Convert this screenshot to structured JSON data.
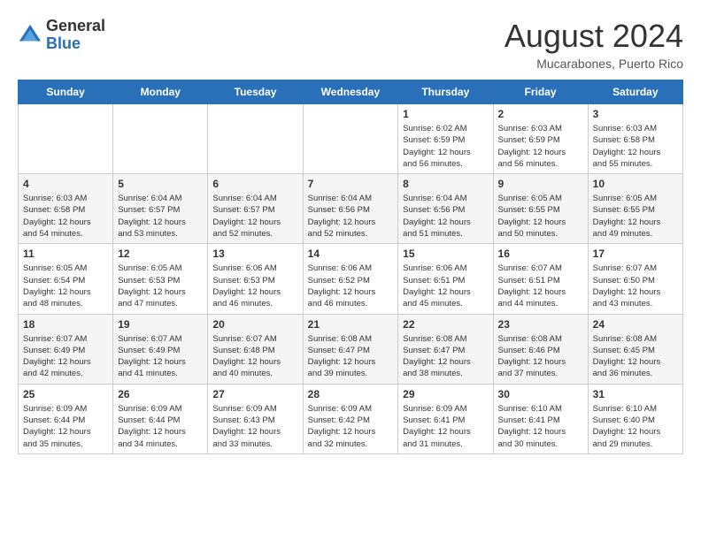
{
  "header": {
    "logo_general": "General",
    "logo_blue": "Blue",
    "month_year": "August 2024",
    "location": "Mucarabones, Puerto Rico"
  },
  "weekdays": [
    "Sunday",
    "Monday",
    "Tuesday",
    "Wednesday",
    "Thursday",
    "Friday",
    "Saturday"
  ],
  "weeks": [
    [
      {
        "day": "",
        "info": ""
      },
      {
        "day": "",
        "info": ""
      },
      {
        "day": "",
        "info": ""
      },
      {
        "day": "",
        "info": ""
      },
      {
        "day": "1",
        "info": "Sunrise: 6:02 AM\nSunset: 6:59 PM\nDaylight: 12 hours\nand 56 minutes."
      },
      {
        "day": "2",
        "info": "Sunrise: 6:03 AM\nSunset: 6:59 PM\nDaylight: 12 hours\nand 56 minutes."
      },
      {
        "day": "3",
        "info": "Sunrise: 6:03 AM\nSunset: 6:58 PM\nDaylight: 12 hours\nand 55 minutes."
      }
    ],
    [
      {
        "day": "4",
        "info": "Sunrise: 6:03 AM\nSunset: 6:58 PM\nDaylight: 12 hours\nand 54 minutes."
      },
      {
        "day": "5",
        "info": "Sunrise: 6:04 AM\nSunset: 6:57 PM\nDaylight: 12 hours\nand 53 minutes."
      },
      {
        "day": "6",
        "info": "Sunrise: 6:04 AM\nSunset: 6:57 PM\nDaylight: 12 hours\nand 52 minutes."
      },
      {
        "day": "7",
        "info": "Sunrise: 6:04 AM\nSunset: 6:56 PM\nDaylight: 12 hours\nand 52 minutes."
      },
      {
        "day": "8",
        "info": "Sunrise: 6:04 AM\nSunset: 6:56 PM\nDaylight: 12 hours\nand 51 minutes."
      },
      {
        "day": "9",
        "info": "Sunrise: 6:05 AM\nSunset: 6:55 PM\nDaylight: 12 hours\nand 50 minutes."
      },
      {
        "day": "10",
        "info": "Sunrise: 6:05 AM\nSunset: 6:55 PM\nDaylight: 12 hours\nand 49 minutes."
      }
    ],
    [
      {
        "day": "11",
        "info": "Sunrise: 6:05 AM\nSunset: 6:54 PM\nDaylight: 12 hours\nand 48 minutes."
      },
      {
        "day": "12",
        "info": "Sunrise: 6:05 AM\nSunset: 6:53 PM\nDaylight: 12 hours\nand 47 minutes."
      },
      {
        "day": "13",
        "info": "Sunrise: 6:06 AM\nSunset: 6:53 PM\nDaylight: 12 hours\nand 46 minutes."
      },
      {
        "day": "14",
        "info": "Sunrise: 6:06 AM\nSunset: 6:52 PM\nDaylight: 12 hours\nand 46 minutes."
      },
      {
        "day": "15",
        "info": "Sunrise: 6:06 AM\nSunset: 6:51 PM\nDaylight: 12 hours\nand 45 minutes."
      },
      {
        "day": "16",
        "info": "Sunrise: 6:07 AM\nSunset: 6:51 PM\nDaylight: 12 hours\nand 44 minutes."
      },
      {
        "day": "17",
        "info": "Sunrise: 6:07 AM\nSunset: 6:50 PM\nDaylight: 12 hours\nand 43 minutes."
      }
    ],
    [
      {
        "day": "18",
        "info": "Sunrise: 6:07 AM\nSunset: 6:49 PM\nDaylight: 12 hours\nand 42 minutes."
      },
      {
        "day": "19",
        "info": "Sunrise: 6:07 AM\nSunset: 6:49 PM\nDaylight: 12 hours\nand 41 minutes."
      },
      {
        "day": "20",
        "info": "Sunrise: 6:07 AM\nSunset: 6:48 PM\nDaylight: 12 hours\nand 40 minutes."
      },
      {
        "day": "21",
        "info": "Sunrise: 6:08 AM\nSunset: 6:47 PM\nDaylight: 12 hours\nand 39 minutes."
      },
      {
        "day": "22",
        "info": "Sunrise: 6:08 AM\nSunset: 6:47 PM\nDaylight: 12 hours\nand 38 minutes."
      },
      {
        "day": "23",
        "info": "Sunrise: 6:08 AM\nSunset: 6:46 PM\nDaylight: 12 hours\nand 37 minutes."
      },
      {
        "day": "24",
        "info": "Sunrise: 6:08 AM\nSunset: 6:45 PM\nDaylight: 12 hours\nand 36 minutes."
      }
    ],
    [
      {
        "day": "25",
        "info": "Sunrise: 6:09 AM\nSunset: 6:44 PM\nDaylight: 12 hours\nand 35 minutes."
      },
      {
        "day": "26",
        "info": "Sunrise: 6:09 AM\nSunset: 6:44 PM\nDaylight: 12 hours\nand 34 minutes."
      },
      {
        "day": "27",
        "info": "Sunrise: 6:09 AM\nSunset: 6:43 PM\nDaylight: 12 hours\nand 33 minutes."
      },
      {
        "day": "28",
        "info": "Sunrise: 6:09 AM\nSunset: 6:42 PM\nDaylight: 12 hours\nand 32 minutes."
      },
      {
        "day": "29",
        "info": "Sunrise: 6:09 AM\nSunset: 6:41 PM\nDaylight: 12 hours\nand 31 minutes."
      },
      {
        "day": "30",
        "info": "Sunrise: 6:10 AM\nSunset: 6:41 PM\nDaylight: 12 hours\nand 30 minutes."
      },
      {
        "day": "31",
        "info": "Sunrise: 6:10 AM\nSunset: 6:40 PM\nDaylight: 12 hours\nand 29 minutes."
      }
    ]
  ]
}
